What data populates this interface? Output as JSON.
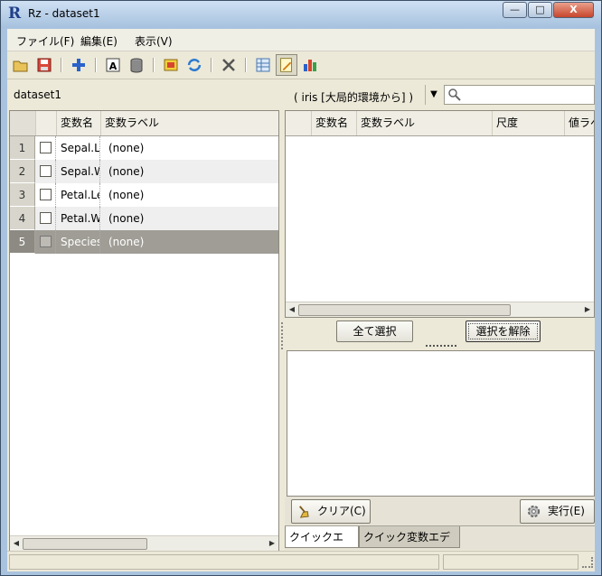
{
  "window": {
    "title": "Rz - dataset1",
    "minimize": "—",
    "maximize": "□",
    "close": "X"
  },
  "menu": [
    {
      "label": "ファイル(F)"
    },
    {
      "label": "編集(E)"
    },
    {
      "label": "表示(V)"
    }
  ],
  "toolbar": {
    "icons": [
      "open-folder-icon",
      "save-icon",
      "add-icon",
      "text-a-icon",
      "delete-bin-icon",
      "import-data-icon",
      "refresh-icon",
      "tools-icon",
      "grid-view-icon",
      "edit-view-icon",
      "bar-chart-icon"
    ]
  },
  "dataset_bar": {
    "name": "dataset1",
    "combo_value": "( iris [大局的環境から] )",
    "search_value": ""
  },
  "left_grid": {
    "headers": {
      "name": "変数名",
      "label": "変数ラベル"
    },
    "rows": [
      {
        "num": "1",
        "name": "Sepal.Length",
        "label": "(none)"
      },
      {
        "num": "2",
        "name": "Sepal.Width",
        "label": "(none)"
      },
      {
        "num": "3",
        "name": "Petal.Length",
        "label": "(none)"
      },
      {
        "num": "4",
        "name": "Petal.Width",
        "label": "(none)"
      },
      {
        "num": "5",
        "name": "Species",
        "label": "(none)"
      }
    ]
  },
  "right_grid": {
    "headers": {
      "name": "変数名",
      "label": "変数ラベル",
      "scale": "尺度",
      "value_label": "値ラベル"
    }
  },
  "buttons": {
    "select_all": "全て選択",
    "deselect": "選択を解除",
    "clear": "クリア(C)",
    "run": "実行(E)"
  },
  "tabs": {
    "quick_editor": "クイックエディタ",
    "quick_var_editor": "クイック変数エディタ"
  }
}
